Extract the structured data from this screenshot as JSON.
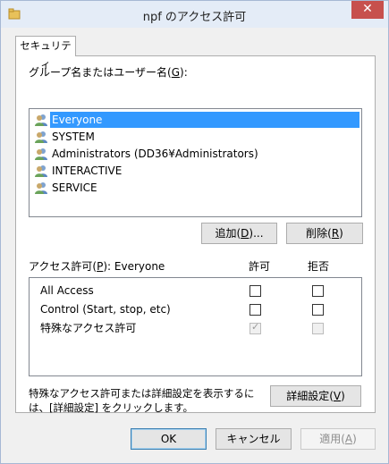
{
  "window": {
    "title": "npf のアクセス許可",
    "close_label": "✕"
  },
  "tab": {
    "label": "セキュリティ"
  },
  "users_section": {
    "label": "グループ名またはユーザー名(",
    "accel": "G",
    "label_end": "):",
    "items": [
      {
        "name": "Everyone",
        "selected": true
      },
      {
        "name": "SYSTEM",
        "selected": false
      },
      {
        "name": "Administrators (DD36¥Administrators)",
        "selected": false
      },
      {
        "name": "INTERACTIVE",
        "selected": false
      },
      {
        "name": "SERVICE",
        "selected": false
      }
    ]
  },
  "buttons": {
    "add_pre": "追加(",
    "add_accel": "D",
    "add_post": ")...",
    "remove_pre": "削除(",
    "remove_accel": "R",
    "remove_post": ")",
    "advanced_pre": "詳細設定(",
    "advanced_accel": "V",
    "advanced_post": ")",
    "ok": "OK",
    "cancel": "キャンセル",
    "apply_pre": "適用(",
    "apply_accel": "A",
    "apply_post": ")"
  },
  "permissions": {
    "label_pre": "アクセス許可(",
    "label_accel": "P",
    "label_post": "): Everyone",
    "allow_header": "許可",
    "deny_header": "拒否",
    "rows": [
      {
        "name": "All Access",
        "allow": false,
        "deny": false,
        "disabled": false
      },
      {
        "name": "Control (Start, stop, etc)",
        "allow": false,
        "deny": false,
        "disabled": false
      },
      {
        "name": "特殊なアクセス許可",
        "allow": true,
        "deny": false,
        "disabled": true
      }
    ]
  },
  "hint": {
    "line1": "特殊なアクセス許可または詳細設定を表示するに",
    "line2": "は、[詳細設定] をクリックします。"
  },
  "colors": {
    "selection": "#3399ff",
    "close_button": "#c7504d",
    "titlebar": "#e4ecf7"
  },
  "icons": {
    "title": "folder-icon",
    "user": "users-group-icon"
  }
}
